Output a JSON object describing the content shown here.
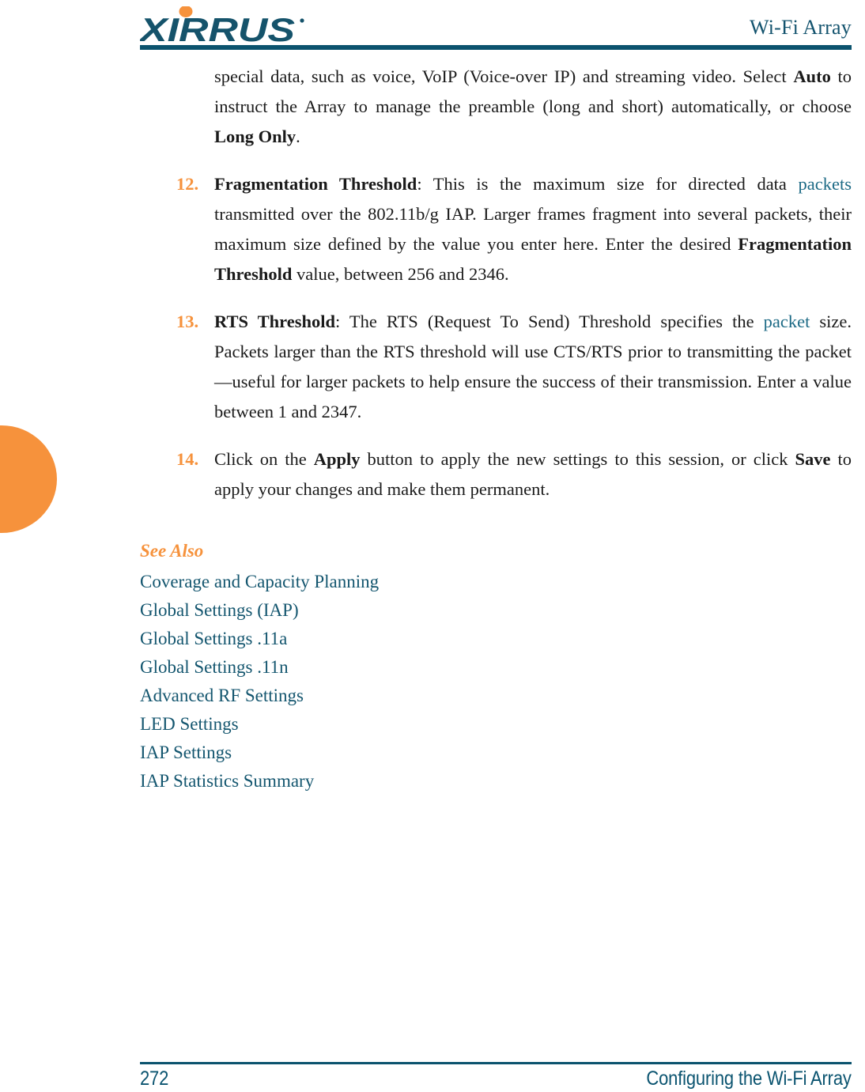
{
  "theme": {
    "accent_orange": "#F6923C",
    "accent_teal": "#0B536E",
    "link_teal": "#1C6A85",
    "see_also_teal": "#14566F",
    "body_text": "#1a1a1a"
  },
  "header": {
    "logo_text": "XIRRUS",
    "logo_trademark": "®",
    "title": "Wi-Fi Array"
  },
  "body": {
    "lead_paragraph": {
      "text_1": "special data, such as voice, VoIP (Voice-over IP) and streaming video. Select ",
      "bold_1": "Auto",
      "text_2": " to instruct the Array to manage the preamble (long and short) automatically, or choose ",
      "bold_2": "Long Only",
      "text_3": "."
    },
    "items": [
      {
        "number": "12.",
        "bold_lead": "Fragmentation Threshold",
        "text_1": ": This is the maximum size for directed data ",
        "link_1": "packets",
        "text_2": " transmitted over the 802.11b/g IAP. Larger frames fragment into several packets, their maximum size defined by the value you enter here. Enter the desired ",
        "bold_2": "Fragmentation Threshold",
        "text_3": " value, between 256 and 2346."
      },
      {
        "number": "13.",
        "bold_lead": "RTS Threshold",
        "text_1": ": The RTS (Request To Send) Threshold specifies the ",
        "link_1": "packet",
        "text_2": " size. Packets larger than the RTS threshold will use CTS/RTS prior to transmitting the packet—useful for larger packets to help ensure the success of their transmission. Enter a value between 1 and 2347.",
        "bold_2": "",
        "text_3": ""
      },
      {
        "number": "14.",
        "bold_lead": "",
        "text_1": "Click on the ",
        "link_1": "",
        "text_2": "",
        "bold_2": "",
        "text_3": ""
      }
    ],
    "item14": {
      "number": "14.",
      "text_1": "Click on the ",
      "bold_1": "Apply",
      "text_2": " button to apply the new settings to this session, or click ",
      "bold_2": "Save",
      "text_3": " to apply your changes and make them permanent."
    }
  },
  "see_also": {
    "title": "See Also",
    "links": [
      "Coverage and Capacity Planning",
      "Global Settings (IAP)",
      "Global Settings .11a",
      "Global Settings .11n",
      "Advanced RF Settings",
      "LED Settings",
      "IAP Settings",
      "IAP Statistics Summary"
    ]
  },
  "footer": {
    "page_number": "272",
    "section_title": "Configuring the Wi-Fi Array"
  }
}
